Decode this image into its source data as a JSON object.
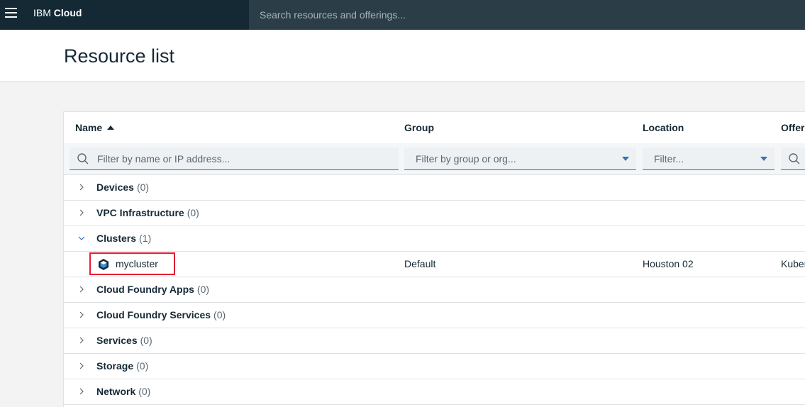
{
  "topbar": {
    "brand_prefix": "IBM",
    "brand_name": "Cloud",
    "search_placeholder": "Search resources and offerings..."
  },
  "page": {
    "title": "Resource list"
  },
  "table": {
    "columns": {
      "name": "Name",
      "group": "Group",
      "location": "Location",
      "offering": "Offer"
    },
    "filters": {
      "name_placeholder": "Filter by name or IP address...",
      "group_placeholder": "Filter by group or org...",
      "location_placeholder": "Filter..."
    },
    "groups": [
      {
        "label": "Devices",
        "count": "(0)"
      },
      {
        "label": "VPC Infrastructure",
        "count": "(0)"
      },
      {
        "label": "Clusters",
        "count": "(1)"
      },
      {
        "label": "Cloud Foundry Apps",
        "count": "(0)"
      },
      {
        "label": "Cloud Foundry Services",
        "count": "(0)"
      },
      {
        "label": "Services",
        "count": "(0)"
      },
      {
        "label": "Storage",
        "count": "(0)"
      },
      {
        "label": "Network",
        "count": "(0)"
      }
    ],
    "cluster_row": {
      "name": "mycluster",
      "group": "Default",
      "location": "Houston 02",
      "offering": "Kuber"
    }
  },
  "colors": {
    "topbar_bg": "#152935",
    "highlight": "#e71d32",
    "accent": "#3d70b2"
  }
}
